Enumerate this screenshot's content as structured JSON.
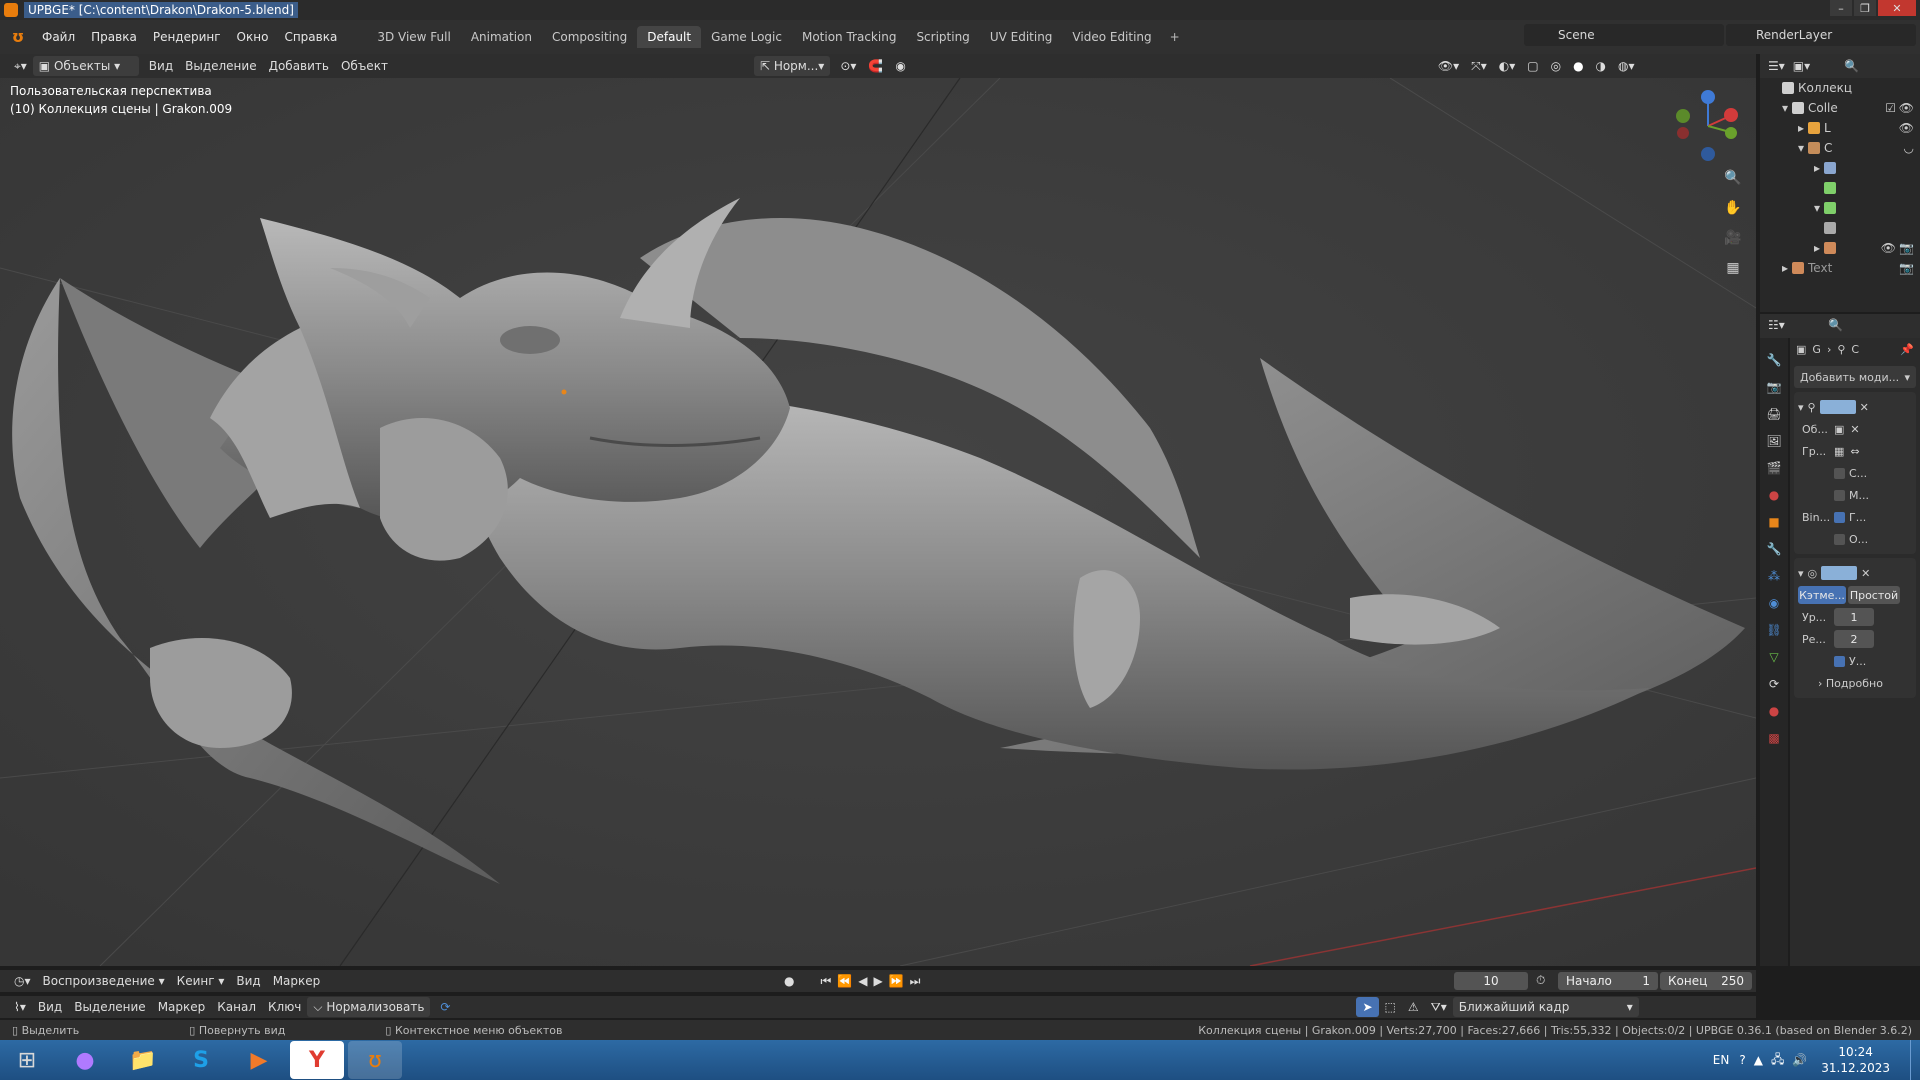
{
  "window": {
    "title": "UPBGE* [C:\\content\\Drakon\\Drakon-5.blend]"
  },
  "menu": [
    "Файл",
    "Правка",
    "Рендеринг",
    "Окно",
    "Справка"
  ],
  "workspaces": [
    {
      "label": "3D View Full",
      "active": false
    },
    {
      "label": "Animation",
      "active": false
    },
    {
      "label": "Compositing",
      "active": false
    },
    {
      "label": "Default",
      "active": true
    },
    {
      "label": "Game Logic",
      "active": false
    },
    {
      "label": "Motion Tracking",
      "active": false
    },
    {
      "label": "Scripting",
      "active": false
    },
    {
      "label": "UV Editing",
      "active": false
    },
    {
      "label": "Video Editing",
      "active": false
    }
  ],
  "scene": {
    "name": "Scene"
  },
  "render_layer": {
    "name": "RenderLayer"
  },
  "viewport_header": {
    "mode": "Объекты",
    "items": [
      "Вид",
      "Выделение",
      "Добавить",
      "Объект"
    ],
    "orientation": "Норм..."
  },
  "viewport": {
    "perspective": "Пользовательская перспектива",
    "collection_info": "(10) Коллекция сцены | Grakon.009"
  },
  "outliner": {
    "root": "Коллекц",
    "rows": [
      {
        "label": "Colle",
        "color": "#cfcfcf"
      },
      {
        "label": "L",
        "color": "#e8a33d"
      },
      {
        "label": "C",
        "color": "#c58d5a"
      },
      {
        "label": "",
        "color": "#8aa6cf"
      },
      {
        "label": "",
        "color": "#7fcf6a"
      },
      {
        "label": "",
        "color": "#7fcf6a"
      },
      {
        "label": "",
        "color": "#aaaaaa"
      },
      {
        "label": "",
        "color": "#cf8a5a"
      },
      {
        "label": "Text",
        "color": "#cf8a5a"
      }
    ]
  },
  "properties": {
    "breadcrumb": [
      "G",
      "C"
    ],
    "add_modifier": "Добавить моди...",
    "armature_mod": {
      "object_label": "Об...",
      "group_label": "Гр...",
      "checks": [
        {
          "label": "С...",
          "on": false
        },
        {
          "label": "М...",
          "on": false
        }
      ],
      "bind_label": "Bin...",
      "bind_checks": [
        {
          "label": "Г...",
          "on": true
        },
        {
          "label": "О...",
          "on": false
        }
      ]
    },
    "subsurf_mod": {
      "mode_a": "Кэтме...",
      "mode_b": "Простой",
      "levels_label": "Ур...",
      "levels": "1",
      "render_label": "Ре...",
      "render": "2",
      "check_label": "У...",
      "advanced": "Подробно"
    }
  },
  "timeline": {
    "items": [
      "Воспроизведение",
      "Кеинг",
      "Вид",
      "Маркер"
    ],
    "current": "10",
    "start_label": "Начало",
    "start": "1",
    "end_label": "Конец",
    "end": "250"
  },
  "graph_header": {
    "items": [
      "Вид",
      "Выделение",
      "Маркер",
      "Канал",
      "Ключ"
    ],
    "normalize": "Нормализовать",
    "snap": "Ближайший кадр"
  },
  "status": {
    "select": "Выделить",
    "rotate": "Повернуть вид",
    "context": "Контекстное меню объектов",
    "stats": "Коллекция сцены | Grakon.009 | Verts:27,700 | Faces:27,666 | Tris:55,332 | Objects:0/2 | UPBGE 0.36.1 (based on Blender 3.6.2)"
  },
  "taskbar": {
    "lang": "EN",
    "time": "10:24",
    "date": "31.12.2023"
  }
}
